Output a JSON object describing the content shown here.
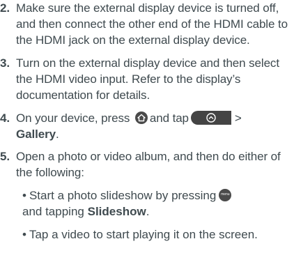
{
  "steps": [
    {
      "number": "2.",
      "text": "Make sure the external display device is turned off, and then connect the other end of the HDMI cable to the HDMI jack on the external display device."
    },
    {
      "number": "3.",
      "text": "Turn on the external display device and then select the HDMI video input. Refer to the display’s documentation for details."
    },
    {
      "number": "4.",
      "text_before": "On your device, press",
      "text_middle": "and tap",
      "arrow": ">",
      "bold": "Gallery",
      "text_end": "."
    },
    {
      "number": "5.",
      "text": "Open a photo or video album, and then do either of the following:"
    }
  ],
  "sub_items": [
    {
      "bullet": "•",
      "text_before": "Start a photo slideshow by pressing",
      "text_middle": "and tapping",
      "bold": "Slideshow",
      "text_end": "."
    },
    {
      "bullet": "•",
      "text": "Tap a video to start playing it on the screen."
    }
  ],
  "icons": {
    "home": "home-icon",
    "launch_bar": "launch-bar-icon",
    "menu": "menu-icon",
    "menu_label": "menu"
  }
}
